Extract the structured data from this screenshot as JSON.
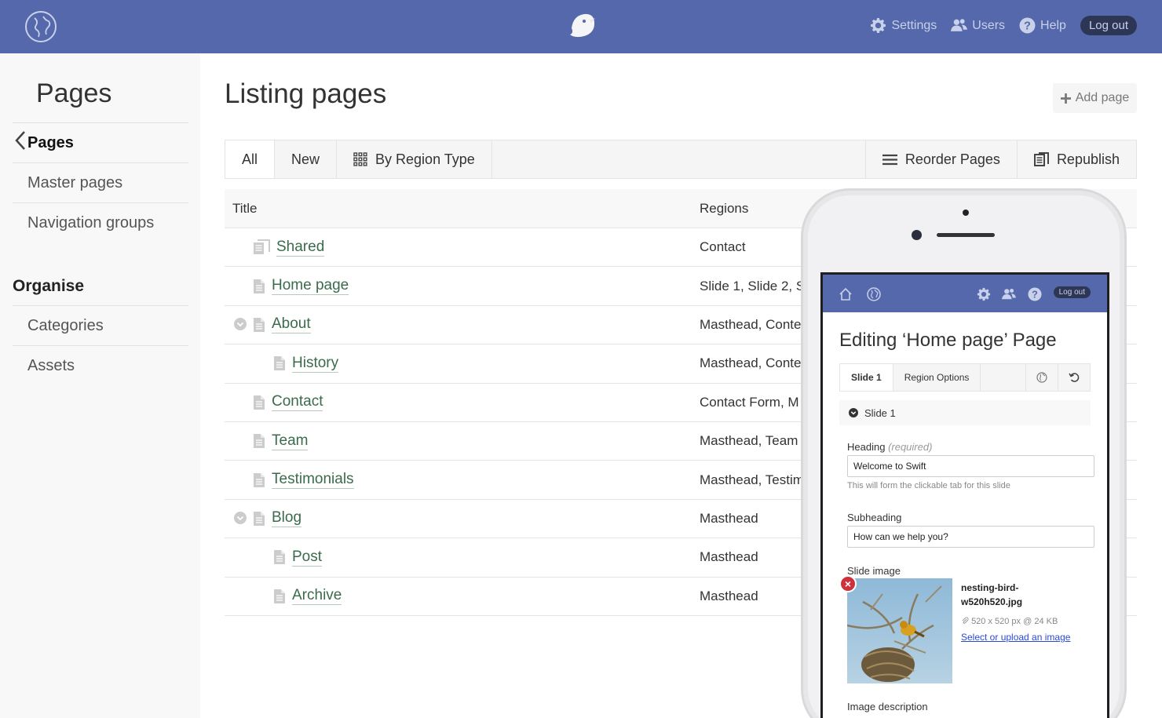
{
  "topbar": {
    "nav": [
      {
        "label": "Settings",
        "icon": "gear-icon"
      },
      {
        "label": "Users",
        "icon": "users-icon"
      },
      {
        "label": "Help",
        "icon": "help-icon"
      }
    ],
    "logout_label": "Log out"
  },
  "sidebar": {
    "title": "Pages",
    "items": [
      "Pages",
      "Master pages",
      "Navigation groups"
    ],
    "heading": "Organise",
    "organise_items": [
      "Categories",
      "Assets"
    ]
  },
  "main": {
    "title": "Listing pages",
    "add_label": "Add page",
    "tabs": [
      "All",
      "New",
      "By Region Type"
    ],
    "right_tabs": [
      "Reorder Pages",
      "Republish"
    ],
    "columns": [
      "Title",
      "Regions"
    ],
    "rows": [
      {
        "title": "Shared",
        "regions": "Contact"
      },
      {
        "title": "Home page",
        "regions": "Slide 1, Slide 2, S"
      },
      {
        "title": "About",
        "regions": "Masthead, Conte"
      },
      {
        "title": "History",
        "regions": "Masthead, Conte"
      },
      {
        "title": "Contact",
        "regions": "Contact Form, M"
      },
      {
        "title": "Team",
        "regions": "Masthead, Team"
      },
      {
        "title": "Testimonials",
        "regions": "Masthead, Testim"
      },
      {
        "title": "Blog",
        "regions": "Masthead"
      },
      {
        "title": "Post",
        "regions": "Masthead"
      },
      {
        "title": "Archive",
        "regions": "Masthead"
      }
    ]
  },
  "phone": {
    "logout_label": "Log out",
    "title": "Editing ‘Home page’ Page",
    "tabs": [
      "Slide 1",
      "Region Options"
    ],
    "slide_label": "Slide 1",
    "heading_label": "Heading",
    "heading_required": "(required)",
    "heading_value": "Welcome to Swift",
    "heading_help": "This will form the clickable tab for this slide",
    "subheading_label": "Subheading",
    "subheading_value": "How can we help you?",
    "image_label": "Slide image",
    "image_filename": "nesting-bird-w520h520.jpg",
    "image_meta": "520 x 520 px @ 24 KB",
    "image_link": "Select or upload an image",
    "image_desc_label": "Image description"
  }
}
